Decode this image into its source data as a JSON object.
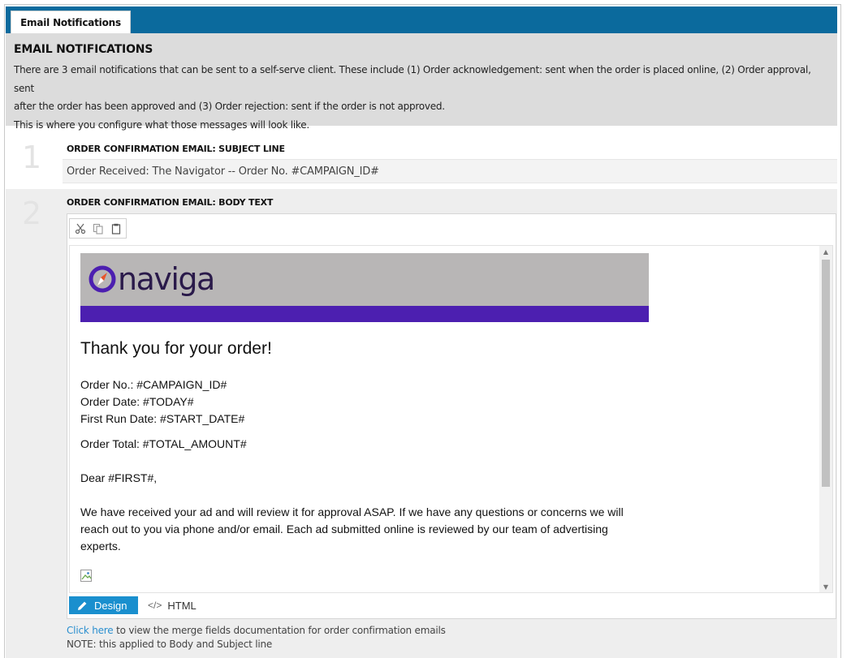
{
  "tab": {
    "label": "Email Notifications"
  },
  "intro": {
    "heading": "EMAIL NOTIFICATIONS",
    "line1": "There are 3 email notifications that can be sent to a self-serve client. These include (1) Order acknowledgement: sent when the order is placed online, (2) Order approval, sent",
    "line2": "after the order has been approved and (3) Order rejection: sent if the order is not approved.",
    "line3": "This is where you configure what those messages will look like."
  },
  "step1": {
    "number": "1",
    "label": "ORDER CONFIRMATION EMAIL: SUBJECT LINE",
    "value": "Order Received: The Navigator -- Order No. #CAMPAIGN_ID#"
  },
  "step2": {
    "number": "2",
    "label": "ORDER CONFIRMATION EMAIL: BODY TEXT"
  },
  "toolbar": {
    "cut_icon": "scissors-icon",
    "copy_icon": "copy-icon",
    "paste_icon": "clipboard-icon"
  },
  "email": {
    "logo_text": "naviga",
    "banner_color": "#b8b6b6",
    "stripe_color": "#4c1fb0",
    "thanks": "Thank you for your order!",
    "order_no": "Order No.: #CAMPAIGN_ID#",
    "order_date": "Order Date: #TODAY#",
    "first_run": "First Run Date: #START_DATE#",
    "order_total": "Order Total: #TOTAL_AMOUNT#",
    "greeting": "Dear #FIRST#,",
    "paragraph": "We have received your ad and will review it for approval ASAP. If we have any questions or concerns we will reach out to you via phone and/or email. Each ad submitted online is reviewed by our team of advertising experts."
  },
  "modes": {
    "design_label": "Design",
    "html_label": "HTML",
    "accent": "#1a8fce"
  },
  "footer": {
    "link_text": "Click here",
    "link_rest": " to view the merge fields documentation for order confirmation emails",
    "note": "NOTE: this applied to Body and Subject line"
  }
}
